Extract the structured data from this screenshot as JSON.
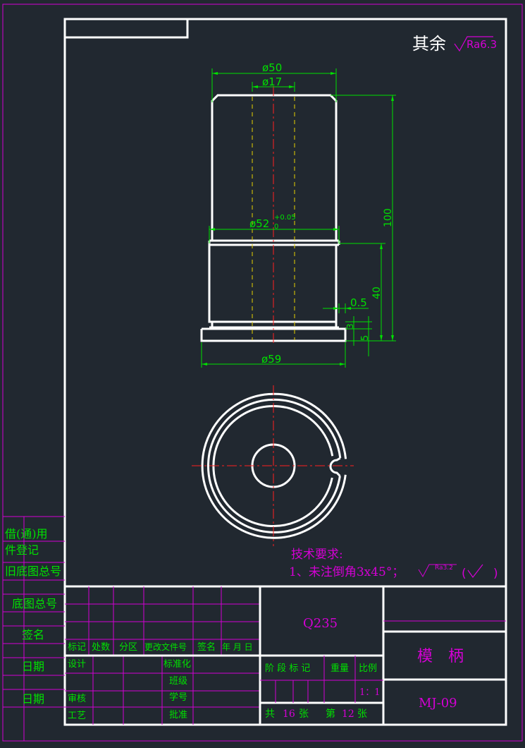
{
  "roughness": {
    "label": "其余",
    "value": "Ra6.3"
  },
  "dims": {
    "d50": "ø50",
    "d17": "ø17",
    "d52": "ø52",
    "d52_sub": "0",
    "d52_tol": "+0.05",
    "len100": "100",
    "len40": "40",
    "d05": "0.5",
    "d3": "3",
    "d5": "5",
    "d59": "ø59"
  },
  "notes": {
    "title": "技术要求:",
    "line1": "1、未注倒角3x45°；",
    "ra": "Ra3.2",
    "paren_open": "(",
    "paren_close": ")"
  },
  "side": {
    "row1": "借(通)用",
    "row2": "件登记",
    "row3": "旧底图总号",
    "row4": "底图总号",
    "row5": "签名",
    "row6": "日期",
    "row7": "日期"
  },
  "title_block": {
    "material": "Q235",
    "part_name": "模　柄",
    "drawing_no": "MJ-09",
    "headers": [
      "标记",
      "处数",
      "分区",
      "更改文件号",
      "签名",
      "年 月 日"
    ],
    "design": "设计",
    "standardize": "标准化",
    "class": "班级",
    "review": "审核",
    "student_no": "学号",
    "process": "工艺",
    "approve": "批准",
    "stage_mark": "阶 段 标 记",
    "weight": "重量",
    "scale_label": "比例",
    "scale": "1：1",
    "total_prefix": "共",
    "total": "16",
    "total_unit": "张",
    "sheet_prefix": "第",
    "sheet": "12",
    "sheet_unit": "张"
  }
}
